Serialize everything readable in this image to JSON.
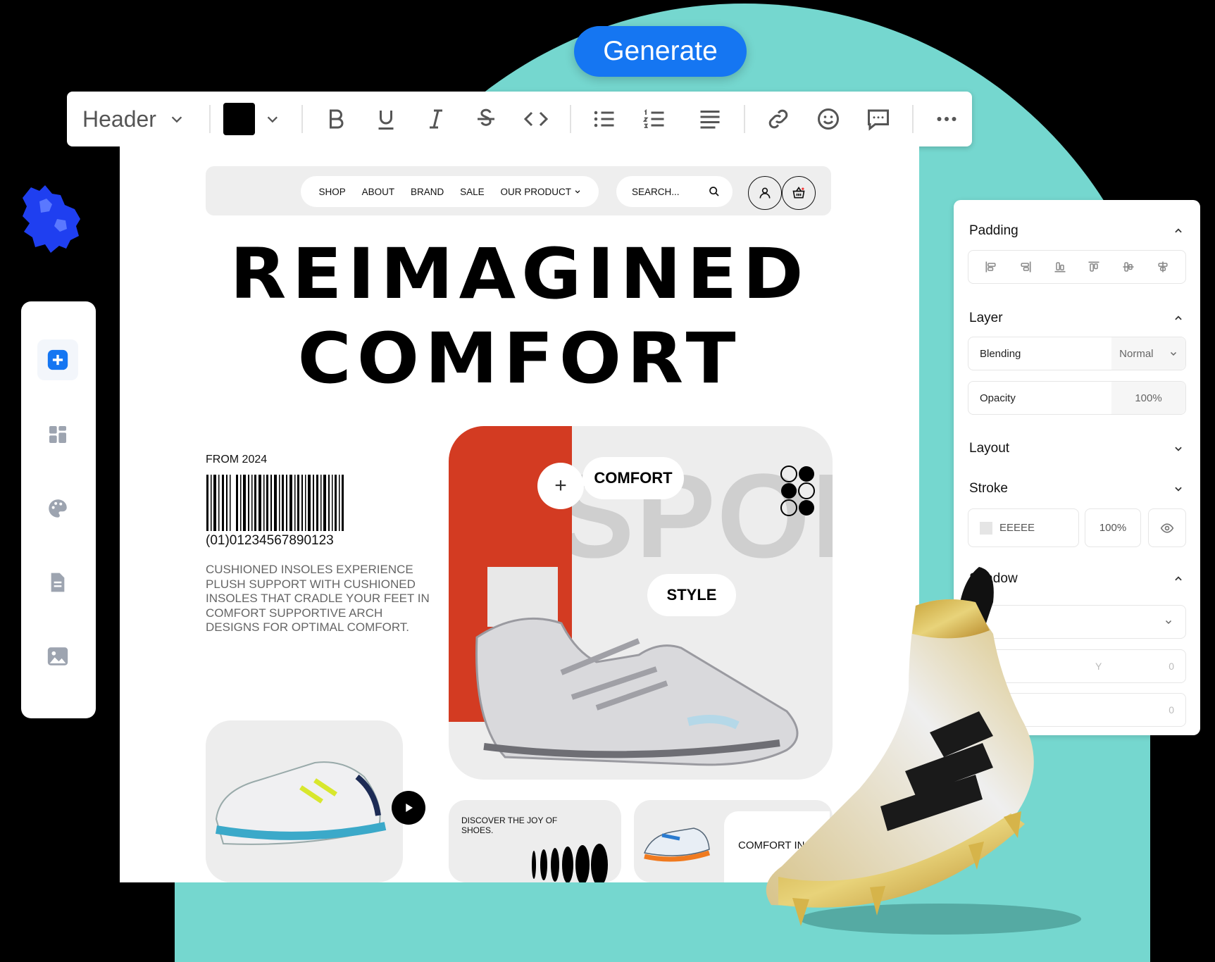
{
  "generate_label": "Generate",
  "toolbar": {
    "style_select": "Header",
    "text_color": "#000000",
    "tools": [
      "bold-icon",
      "underline-icon",
      "italic-icon",
      "strikethrough-icon",
      "code-icon",
      "bullet-list-icon",
      "numbered-list-icon",
      "align-icon",
      "link-icon",
      "emoji-icon",
      "comment-icon",
      "more-icon"
    ]
  },
  "site": {
    "nav": [
      "SHOP",
      "ABOUT",
      "BRAND",
      "SALE",
      "OUR PRODUCT"
    ],
    "search_placeholder": "SEARCH...",
    "hero_line1": "REIMAGINED",
    "hero_line2": "COMFORT",
    "from": "FROM 2024",
    "barcode_number": "(01)01234567890123",
    "description": "CUSHIONED INSOLES EXPERIENCE PLUSH SUPPORT WITH CUSHIONED INSOLES THAT CRADLE YOUR FEET IN COMFORT SUPPORTIVE ARCH DESIGNS FOR OPTIMAL COMFORT.",
    "tag_comfort": "COMFORT",
    "tag_style": "STYLE",
    "bg_word": "SPORT",
    "discover": "DISCOVER THE JOY OF SHOES.",
    "comfort_every": "COMFORT IN EVERY STEP"
  },
  "left_tools": [
    "add-icon",
    "dashboard-icon",
    "palette-icon",
    "document-icon",
    "image-icon"
  ],
  "panel": {
    "padding_title": "Padding",
    "layer_title": "Layer",
    "blending_label": "Blending",
    "blending_value": "Normal",
    "opacity_label": "Opacity",
    "opacity_value": "100%",
    "layout_title": "Layout",
    "stroke_title": "Stroke",
    "stroke_color": "EEEEE",
    "stroke_opacity": "100%",
    "shadow_title": "Shadow",
    "shadow_y": "Y",
    "shadow_val1": "0",
    "shadow_val2": "0"
  },
  "colors": {
    "teal": "#75d7cf",
    "accent": "#1576f2"
  }
}
